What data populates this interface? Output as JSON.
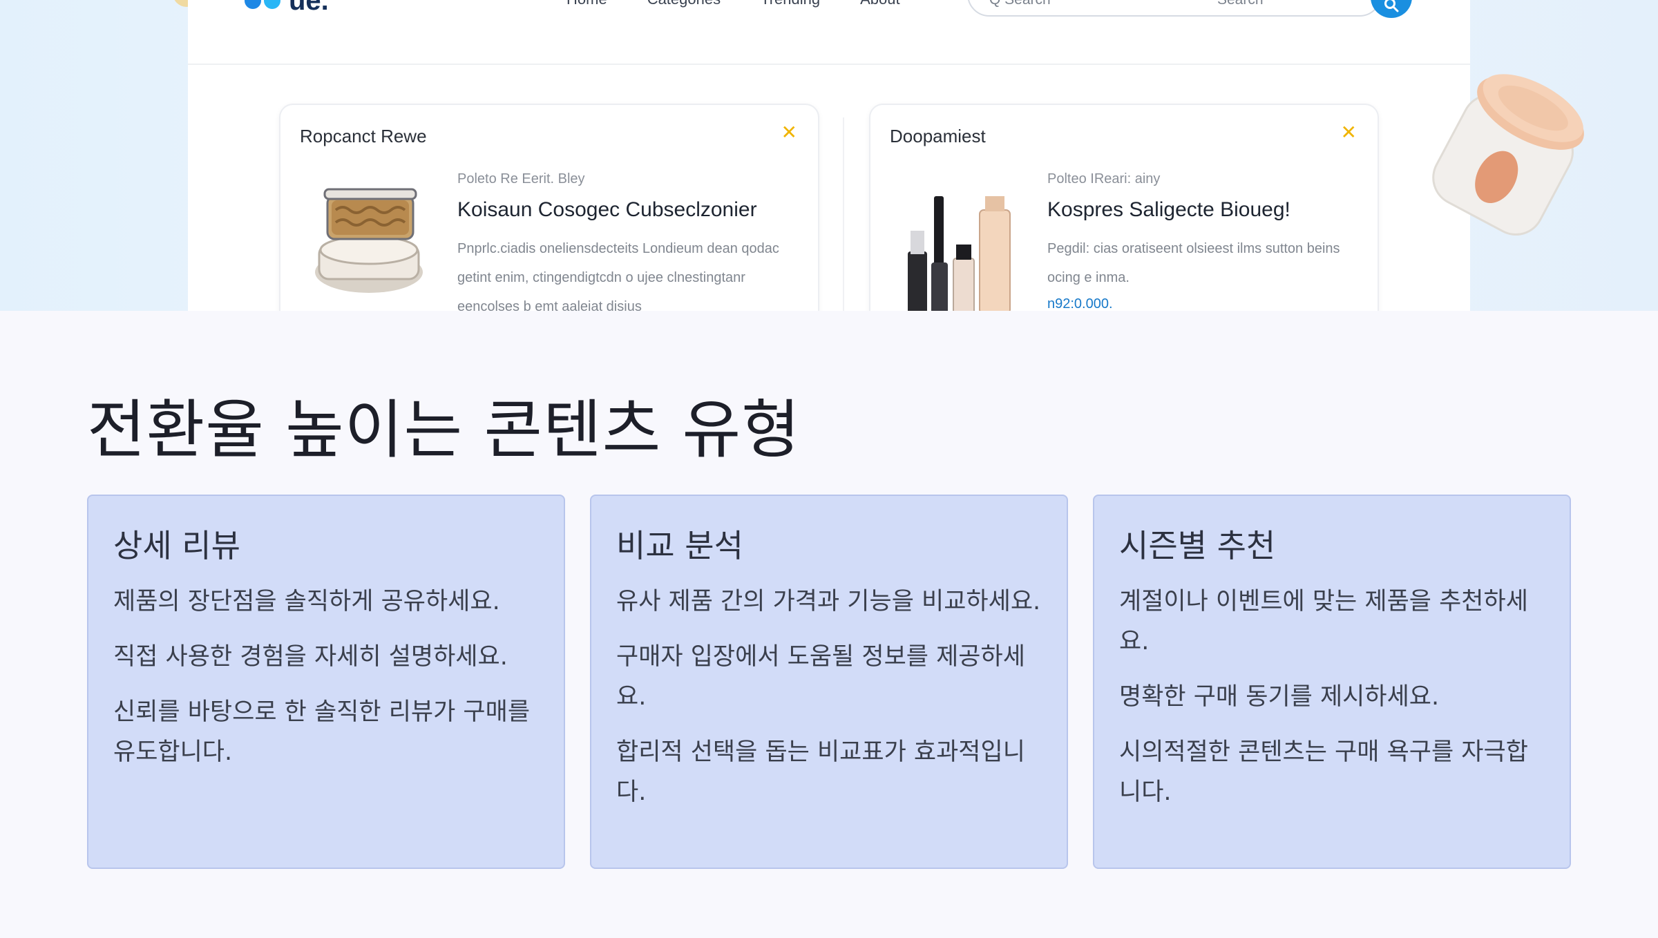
{
  "hero": {
    "brand": "ue.",
    "nav_links": [
      "Home",
      "Categories",
      "Trending",
      "About"
    ],
    "search_placeholder": "Q Search",
    "search_label": "Search",
    "cards": [
      {
        "title": "Ropcanct Rewe",
        "meta": "Poleto Re Eerit. Bley",
        "heading": "Koisaun Cosogec Cubseclzonier",
        "desc": "Pnprlc.ciadis oneliensdecteits Londieum dean qodac getint enim, ctingendigtcdn o ujee clnestingtanr eencolses b emt aaleiat disius",
        "price": ""
      },
      {
        "title": "Doopamiest",
        "meta": "Polteo IReari: ainy",
        "heading": "Kospres Saligecte Bioueg!",
        "desc": "Pegdil: cias oratiseent olsieest ilms sutton beins ocing e inma.",
        "price": "n92:0.000."
      }
    ]
  },
  "section": {
    "title": "전환율 높이는 콘텐츠 유형",
    "types": [
      {
        "title": "상세 리뷰",
        "points": [
          "제품의 장단점을 솔직하게 공유하세요.",
          "직접 사용한 경험을 자세히 설명하세요.",
          "신뢰를 바탕으로 한 솔직한 리뷰가 구매를 유도합니다."
        ]
      },
      {
        "title": "비교 분석",
        "points": [
          "유사 제품 간의 가격과 기능을 비교하세요.",
          "구매자 입장에서 도움될 정보를 제공하세요.",
          "합리적 선택을 돕는 비교표가 효과적입니다."
        ]
      },
      {
        "title": "시즌별 추천",
        "points": [
          "계절이나 이벤트에 맞는 제품을 추천하세요.",
          "명확한 구매 동기를 제시하세요.",
          "시의적절한 콘텐츠는 구매 욕구를 자극합니다."
        ]
      }
    ]
  },
  "colors": {
    "card_bg": "#d2dcf8",
    "card_border": "#b8c5ec",
    "accent_blue": "#1a8fe0",
    "close_yellow": "#f0b400"
  },
  "icons": {
    "logo": "logo-dots-icon",
    "search": "search-icon",
    "close": "close-icon"
  }
}
